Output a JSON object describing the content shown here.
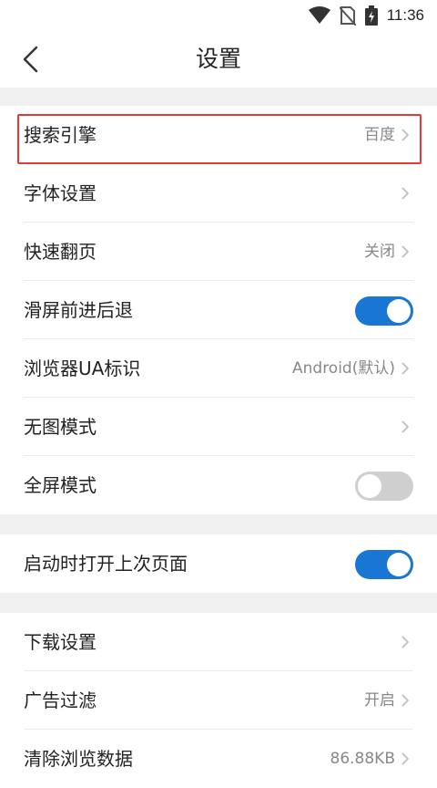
{
  "status_bar": {
    "time": "11:36",
    "icons": [
      "wifi-icon",
      "no-sim-icon",
      "battery-charging-icon"
    ]
  },
  "header": {
    "title": "设置",
    "back_icon": "back-arrow-icon"
  },
  "settings": {
    "group1": [
      {
        "label": "搜索引擎",
        "value": "百度",
        "control": "chevron",
        "highlighted": true
      },
      {
        "label": "字体设置",
        "value": "",
        "control": "chevron"
      },
      {
        "label": "快速翻页",
        "value": "关闭",
        "control": "chevron"
      },
      {
        "label": "滑屏前进后退",
        "control": "toggle",
        "on": true
      },
      {
        "label": "浏览器UA标识",
        "value": "Android(默认)",
        "control": "chevron"
      },
      {
        "label": "无图模式",
        "value": "",
        "control": "chevron"
      },
      {
        "label": "全屏模式",
        "control": "toggle",
        "on": false
      }
    ],
    "group2": [
      {
        "label": "启动时打开上次页面",
        "control": "toggle",
        "on": true
      }
    ],
    "group3": [
      {
        "label": "下载设置",
        "value": "",
        "control": "chevron"
      },
      {
        "label": "广告过滤",
        "value": "开启",
        "control": "chevron"
      },
      {
        "label": "清除浏览数据",
        "value": "86.88KB",
        "control": "chevron"
      }
    ]
  },
  "colors": {
    "accent": "#1976d2",
    "toggle_off": "#cfcfcf",
    "highlight_border": "#e53935",
    "section_gap": "#f0f0f0"
  }
}
